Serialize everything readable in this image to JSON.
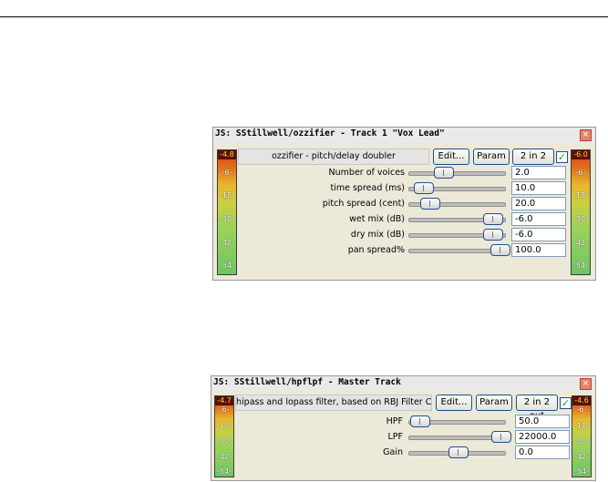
{
  "plugin1": {
    "title": "JS: SStillwell/ozzifier - Track 1 \"Vox Lead\"",
    "description": "ozzifier - pitch/delay doubler",
    "edit_label": "Edit...",
    "param_label": "Param",
    "io_label": "2 in 2 out",
    "enabled": true,
    "meter_left": {
      "peak": "-4.8",
      "ticks": [
        "-6-",
        "-18-",
        "-30-",
        "-42-",
        "-54-"
      ]
    },
    "meter_right": {
      "peak": "-6.0",
      "ticks": [
        "-6-",
        "-18-",
        "-30-",
        "-42-",
        "-54-"
      ]
    },
    "params": [
      {
        "label": "Number of voices",
        "value": "2.0",
        "level": 0.38
      },
      {
        "label": "time spread (ms)",
        "value": "10.0",
        "level": 0.07
      },
      {
        "label": "pitch spread (cent)",
        "value": "20.0",
        "level": 0.2
      },
      {
        "label": "wet mix (dB)",
        "value": "-6.0",
        "level": 0.88
      },
      {
        "label": "dry mix (dB)",
        "value": "-6.0",
        "level": 0.88
      },
      {
        "label": "pan spread%",
        "value": "100.0",
        "level": 1.0
      }
    ]
  },
  "plugin2": {
    "title": "JS: SStillwell/hpflpf - Master Track",
    "description": "hipass and lopass filter, based on RBJ Filter Cookbook",
    "edit_label": "Edit...",
    "param_label": "Param",
    "io_label": "2 in 2 out",
    "enabled": true,
    "meter_left": {
      "peak": "-4.7",
      "ticks": [
        "-6-",
        "-18-",
        "-30-",
        "-42-",
        "-54-"
      ]
    },
    "meter_right": {
      "peak": "-4.6",
      "ticks": [
        "-6-",
        "-18-",
        "-30-",
        "-42-",
        "-54-"
      ]
    },
    "params": [
      {
        "label": "HPF",
        "value": "50.0",
        "level": 0.05
      },
      {
        "label": "LPF",
        "value": "22000.0",
        "level": 1.0
      },
      {
        "label": "Gain",
        "value": "0.0",
        "level": 0.5
      }
    ]
  },
  "icons": {
    "close": "close-icon",
    "check": "checkmark-icon"
  },
  "colors": {
    "close_button": "#e4846d",
    "button_border": "#1d4f8c",
    "check": "#21a121",
    "meter_hot": "#d83a1c",
    "meter_cool": "#6fc662"
  }
}
